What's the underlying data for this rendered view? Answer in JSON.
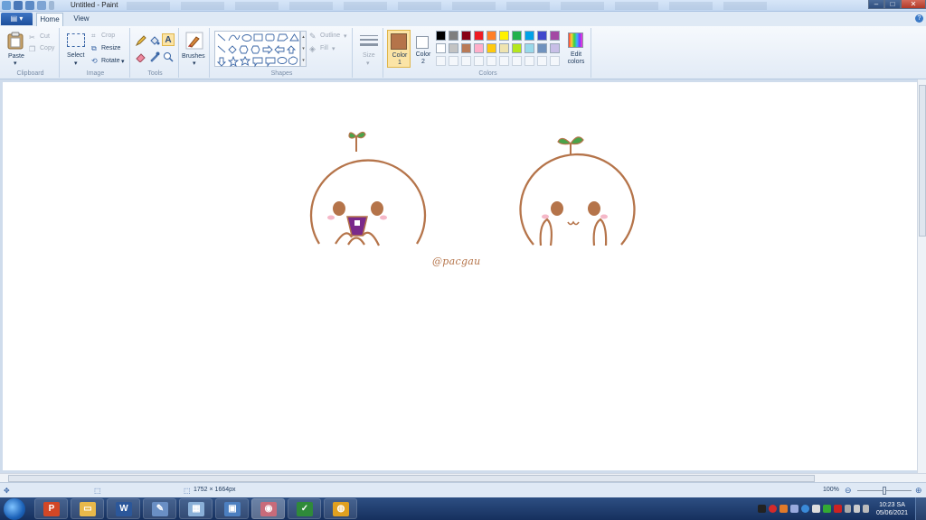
{
  "window": {
    "title": "Untitled - Paint",
    "controls": {
      "minimize": "–",
      "maximize": "□",
      "close": "✕"
    }
  },
  "tabs": [
    {
      "label": "Home",
      "active": true
    },
    {
      "label": "View",
      "active": false
    }
  ],
  "ribbon": {
    "clipboard": {
      "paste": "Paste",
      "cut": "Cut",
      "copy": "Copy",
      "group": "Clipboard"
    },
    "image": {
      "select": "Select",
      "crop": "Crop",
      "resize": "Resize",
      "rotate": "Rotate",
      "group": "Image"
    },
    "tools": {
      "group": "Tools"
    },
    "brushes": {
      "label": "Brushes"
    },
    "shapes": {
      "outline": "Outline",
      "fill": "Fill",
      "group": "Shapes"
    },
    "size": {
      "label": "Size"
    },
    "colors": {
      "color1": "Color 1",
      "color2": "Color 2",
      "edit": "Edit colors",
      "group": "Colors",
      "color1_value": "#b5744a",
      "color2_value": "#ffffff",
      "palette_row1": [
        "#000000",
        "#7f7f7f",
        "#880015",
        "#ed1c24",
        "#ff7f27",
        "#fff200",
        "#22b14c",
        "#00a2e8",
        "#3f48cc",
        "#a349a4"
      ],
      "palette_row2": [
        "#ffffff",
        "#c3c3c3",
        "#b97a57",
        "#ffaec9",
        "#ffc90e",
        "#efe4b0",
        "#b5e61d",
        "#99d9ea",
        "#7092be",
        "#c8bfe7"
      ]
    }
  },
  "canvas": {
    "signature": "@pacgau"
  },
  "statusbar": {
    "dimensions": "1752 × 1664px",
    "zoom": "100%"
  },
  "taskbar": {
    "time": "10:23 SA",
    "date": "05/06/2021",
    "apps": [
      {
        "name": "powerpoint",
        "glyph": "P",
        "color": "#d24726"
      },
      {
        "name": "file-explorer",
        "glyph": "▭",
        "color": "#e8b84a"
      },
      {
        "name": "word",
        "glyph": "W",
        "color": "#2b579a"
      },
      {
        "name": "paint-brush-app",
        "glyph": "✎",
        "color": "#6a8fc4"
      },
      {
        "name": "calculator",
        "glyph": "▦",
        "color": "#8ab0d8"
      },
      {
        "name": "network-app",
        "glyph": "▣",
        "color": "#4c7fc0"
      },
      {
        "name": "paint",
        "glyph": "◉",
        "color": "#c86b7a"
      },
      {
        "name": "excel-like",
        "glyph": "✓",
        "color": "#2f8a3a"
      },
      {
        "name": "chrome",
        "glyph": "◍",
        "color": "#e0a020"
      }
    ]
  }
}
